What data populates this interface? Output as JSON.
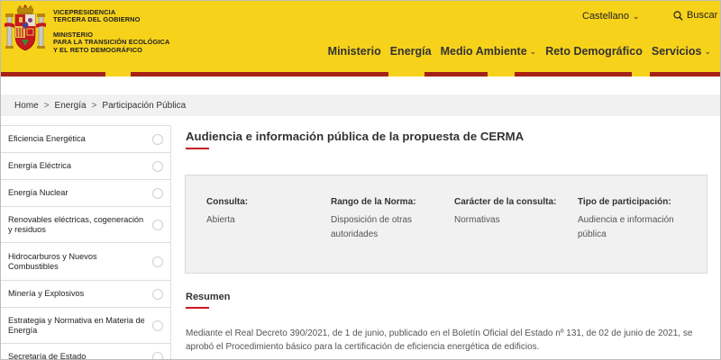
{
  "header": {
    "gov_line1": "VICEPRESIDENCIA",
    "gov_line2": "TERCERA DEL GOBIERNO",
    "ministry_line1": "MINISTERIO",
    "ministry_line2": "PARA LA TRANSICIÓN ECOLÓGICA",
    "ministry_line3": "Y EL RETO DEMOGRÁFICO",
    "language": "Castellano",
    "search_label": "Buscar",
    "brand_yellow": "#f7d21b",
    "brand_red": "#a52016"
  },
  "nav": {
    "items": [
      {
        "label": "Ministerio"
      },
      {
        "label": "Energía"
      },
      {
        "label": "Medio Ambiente"
      },
      {
        "label": "Reto Demográfico"
      },
      {
        "label": "Servicios"
      }
    ]
  },
  "breadcrumb": {
    "items": [
      "Home",
      "Energía",
      "Participación Pública"
    ]
  },
  "sidebar": {
    "items": [
      {
        "label": "Eficiencia Energética"
      },
      {
        "label": "Energía Eléctrica"
      },
      {
        "label": "Energía Nuclear"
      },
      {
        "label": "Renovables eléctricas, cogeneración y residuos"
      },
      {
        "label": "Hidrocarburos y Nuevos Combustibles"
      },
      {
        "label": "Minería y Explosivos"
      },
      {
        "label": "Estrategia y Normativa en Materia de Energía"
      },
      {
        "label": "Secretaría de Estado"
      }
    ]
  },
  "main": {
    "title": "Audiencia e información pública de la propuesta de CERMA",
    "info": [
      {
        "label": "Consulta:",
        "value": "Abierta"
      },
      {
        "label": "Rango de la Norma:",
        "value": "Disposición de otras autoridades"
      },
      {
        "label": "Carácter de la consulta:",
        "value": "Normativas"
      },
      {
        "label": "Tipo de participación:",
        "value": "Audiencia e información pública"
      }
    ],
    "summary_heading": "Resumen",
    "summary_text": "Mediante el Real Decreto 390/2021, de 1 de junio, publicado en el Boletín Oficial del Estado nº 131, de 02 de junio de 2021, se aprobó el Procedimiento básico para la certificación de eficiencia energética de edificios."
  }
}
